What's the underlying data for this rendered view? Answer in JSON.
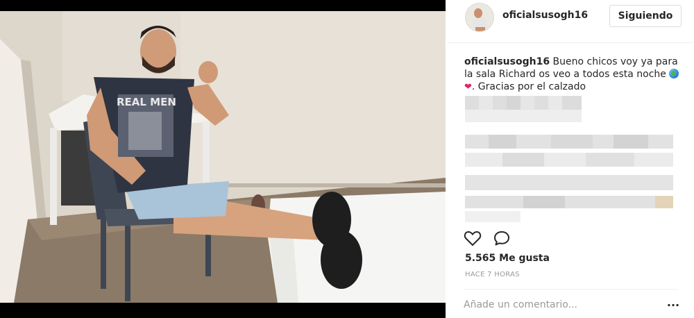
{
  "post": {
    "username": "oficialsusogh16",
    "follow_label": "Siguiendo",
    "caption_user": "oficialsusogh16",
    "caption_text_1": " Bueno chicos voy ya para la sala Richard os veo a todos esta noche ",
    "caption_text_2": ". Gracias por el calzado",
    "emojis": [
      "globe-emoji",
      "heart-emoji"
    ],
    "likes": "5.565 Me gusta",
    "time_ago": "HACE 7 HORAS",
    "comment_placeholder": "Añade un comentario...",
    "more_label": "...",
    "shirt_text": "REAL MEN"
  },
  "icons": {
    "like": "heart-outline-icon",
    "comment": "speech-bubble-icon",
    "options": "ellipsis-icon"
  },
  "colors": {
    "text": "#262626",
    "muted": "#999999",
    "border": "#dbdbdb",
    "divider": "#efefef",
    "photo_frame": "#000000"
  }
}
